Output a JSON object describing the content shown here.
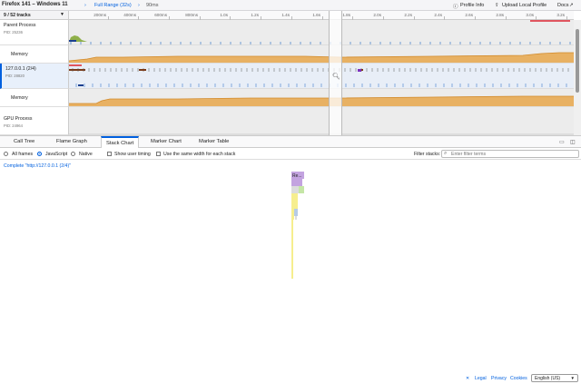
{
  "topbar": {
    "title": "Firefox 141 – Windows 11",
    "full_range": "Full Range (32s)",
    "selection": "90ms",
    "profile_info": "Profile Info",
    "upload": "Upload Local Profile",
    "docs": "Docs"
  },
  "tracks": {
    "count_label": "9 / 52 tracks",
    "ticks": [
      "200ms",
      "400ms",
      "600ms",
      "800ms",
      "1.0s",
      "1.2s",
      "1.4s",
      "1.6s",
      "1.8s",
      "2.0s",
      "2.2s",
      "2.4s",
      "2.6s",
      "2.8s",
      "3.0s",
      "3.2s"
    ],
    "rows": [
      {
        "name": "Parent Process",
        "pid": "PID: 25236"
      },
      {
        "name": "Memory",
        "pid": ""
      },
      {
        "name": "127.0.0.1 (2/4)",
        "pid": "PID: 28820"
      },
      {
        "name": "Memory",
        "pid": ""
      },
      {
        "name": "GPU Process",
        "pid": "PID: 24964"
      }
    ]
  },
  "tabs": [
    "Call Tree",
    "Flame Graph",
    "Stack Chart",
    "Marker Chart",
    "Marker Table"
  ],
  "selected_tab": "Stack Chart",
  "settings": {
    "all_frames": "All frames",
    "javascript": "JavaScript",
    "native": "Native",
    "show_user_timing": "Show user timing",
    "same_width": "Use the same width for each stack",
    "filter_label": "Filter stacks:",
    "filter_placeholder": "Enter filter terms",
    "selected_mode": "JavaScript"
  },
  "breadcrumb": "Complete \"http://127.0.0.1 (2/4)\"",
  "stack_chart": {
    "top_frame_label": "Re...",
    "colors": {
      "purple": "#c3a3e0",
      "green": "#c5e6a6",
      "yellow": "#f6ee8e",
      "blue": "#b6cbe6",
      "gray": "#dcdcdc"
    }
  },
  "footer": {
    "legal": "Legal",
    "privacy": "Privacy",
    "cookies": "Cookies",
    "language": "English (US)"
  },
  "colors": {
    "accent": "#0060df",
    "memory_fill": "#e8a74b",
    "memory_line": "#d28a2a"
  }
}
